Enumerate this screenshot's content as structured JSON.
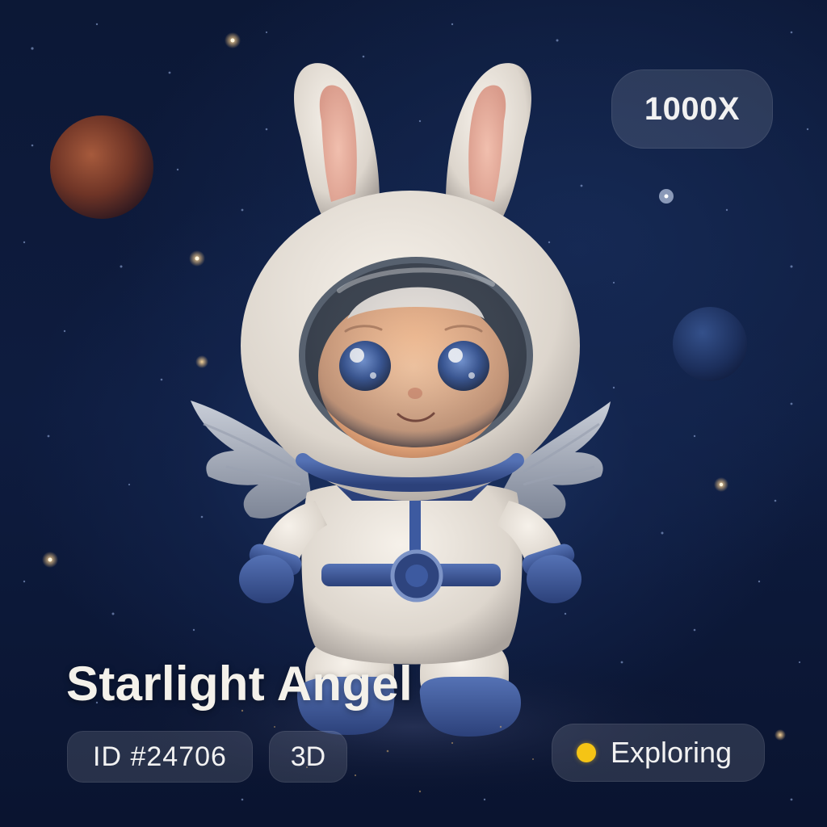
{
  "card": {
    "title": "Starlight Angel",
    "multiplier": "1000X",
    "id_tag": "ID #24706",
    "type_tag": "3D",
    "status": {
      "label": "Exploring",
      "dot_color": "#f5c415"
    }
  },
  "colors": {
    "background": "#0e1c3f",
    "pill_background": "rgba(255,255,255,0.12)",
    "text": "#f2f2f2",
    "accent_blue": "#3d5aa0"
  },
  "icons": [
    "status-dot-icon"
  ]
}
